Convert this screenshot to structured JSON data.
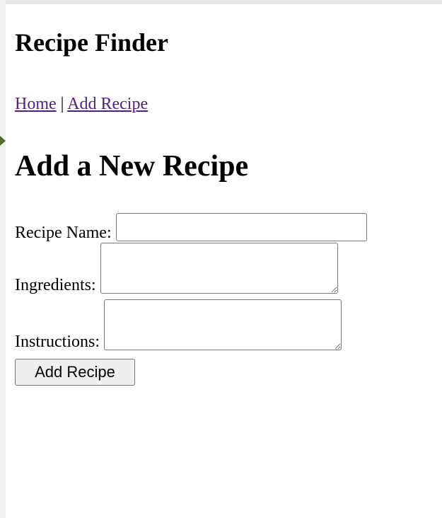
{
  "site": {
    "title": "Recipe Finder"
  },
  "nav": {
    "home_label": "Home",
    "separator": " | ",
    "add_recipe_label": "Add Recipe"
  },
  "page": {
    "title": "Add a New Recipe"
  },
  "form": {
    "recipe_name_label": "Recipe Name:",
    "recipe_name_value": "",
    "ingredients_label": "Ingredients:",
    "ingredients_value": "",
    "instructions_label": "Instructions:",
    "instructions_value": "",
    "submit_label": "Add Recipe"
  }
}
